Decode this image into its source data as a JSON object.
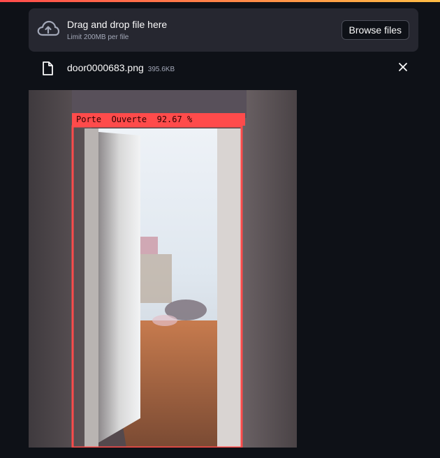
{
  "uploader": {
    "dropzone_title": "Drag and drop file here",
    "dropzone_limit": "Limit 200MB per file",
    "browse_label": "Browse files",
    "icons": {
      "upload": "cloud-upload-icon",
      "file": "file-icon",
      "close": "close-icon"
    }
  },
  "uploaded_file": {
    "name": "door0000683.png",
    "size": "395.6KB"
  },
  "result_image": {
    "detection_label": "Porte  Ouverte  92.67 %",
    "box_color": "#ff4b4b"
  },
  "colors": {
    "background": "#0e1117",
    "panel": "#262730",
    "accent": "#ff4b4b"
  }
}
